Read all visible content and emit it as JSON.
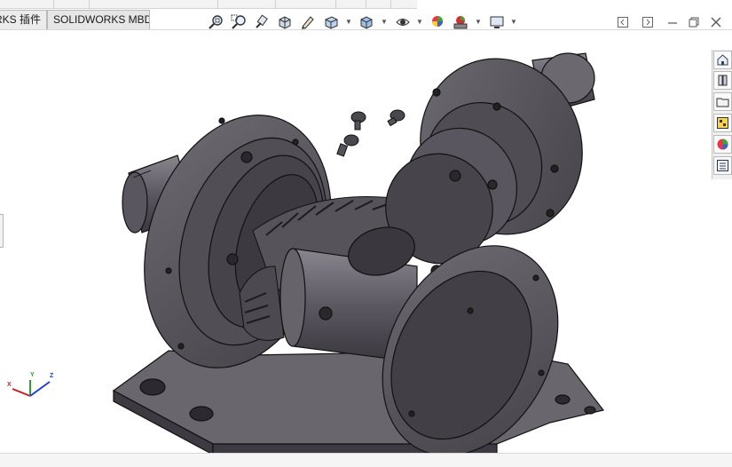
{
  "tabs": [
    {
      "label": "RKS 插件"
    },
    {
      "label": "SOLIDWORKS MBD"
    }
  ],
  "heads_up_toolbar": [
    {
      "icon": "zoom-to-fit-icon"
    },
    {
      "icon": "zoom-to-area-icon"
    },
    {
      "icon": "previous-view-icon"
    },
    {
      "icon": "section-view-icon"
    },
    {
      "icon": "dynamic-annotation-icon"
    },
    {
      "icon": "view-orientation-icon"
    },
    {
      "icon": "display-style-icon"
    },
    {
      "icon": "hide-show-items-icon"
    },
    {
      "icon": "edit-appearance-icon"
    },
    {
      "icon": "apply-scene-icon"
    },
    {
      "icon": "view-settings-icon"
    }
  ],
  "window_controls": [
    {
      "icon": "tile-left-icon"
    },
    {
      "icon": "tile-right-icon"
    },
    {
      "icon": "minimize-icon"
    },
    {
      "icon": "restore-icon"
    },
    {
      "icon": "close-icon"
    }
  ],
  "task_pane": [
    {
      "icon": "solidworks-resources-icon"
    },
    {
      "icon": "design-library-icon"
    },
    {
      "icon": "file-explorer-icon"
    },
    {
      "icon": "view-palette-icon"
    },
    {
      "icon": "appearances-scenes-icon"
    },
    {
      "icon": "custom-properties-icon"
    }
  ],
  "triad": {
    "x": "X",
    "y": "Y",
    "z": "Z"
  },
  "colors": {
    "part_face": "#5b5760",
    "part_dark": "#3e3b42",
    "part_light": "#7a767e",
    "edge": "#111111",
    "axis_x": "#cc1b1b",
    "axis_y": "#2e9e2e",
    "axis_z": "#1f3fd6"
  }
}
